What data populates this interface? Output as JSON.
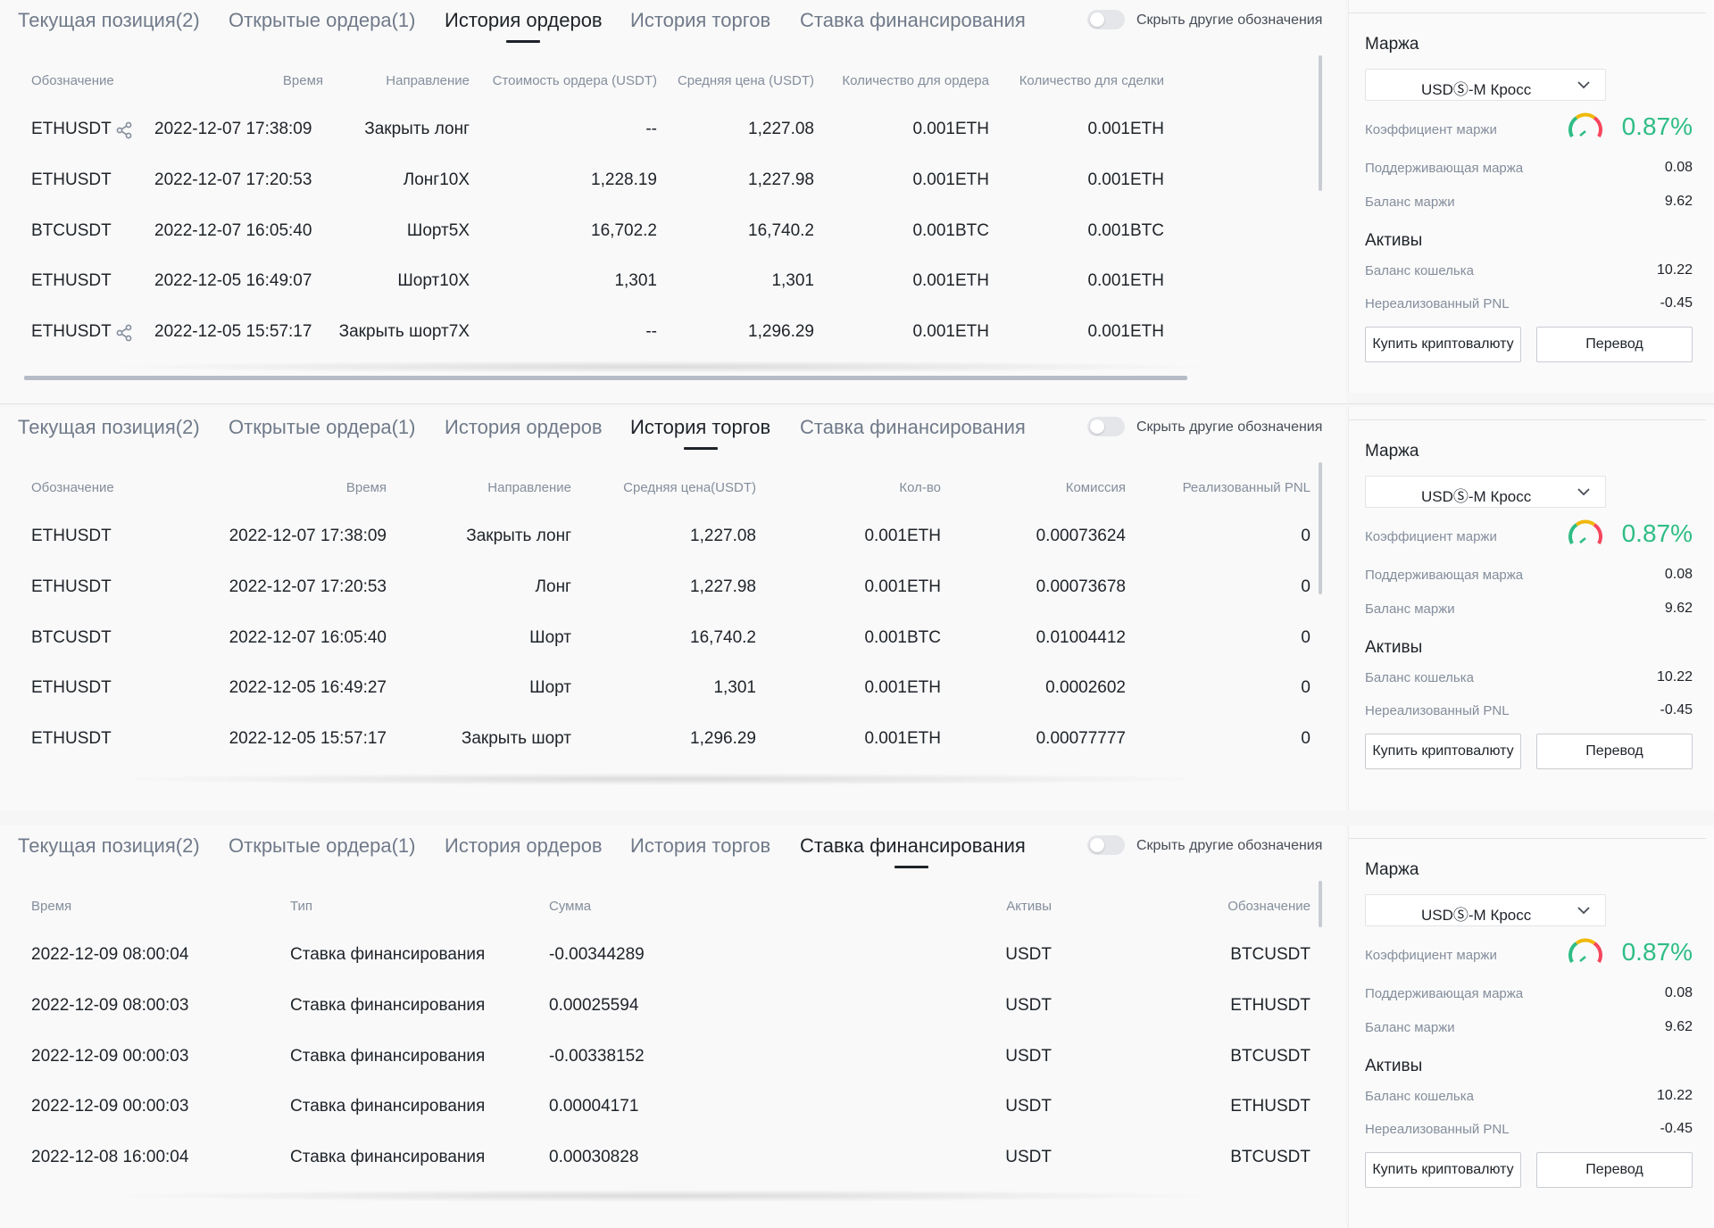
{
  "tabs": {
    "current_position": "Текущая позиция(2)",
    "open_orders": "Открытые ордера(1)",
    "order_history": "История ордеров",
    "trade_history": "История торгов",
    "funding_rate": "Ставка финансирования"
  },
  "hide_other_symbols": "Скрыть другие обозначения",
  "order_history": {
    "headers": [
      "Обозначение",
      "Время",
      "Направление",
      "Стоимость ордера (USDT)",
      "Средняя цена (USDT)",
      "Количество для ордера",
      "Количество для сделки"
    ],
    "rows": [
      [
        "ETHUSDT",
        "2022-12-07 17:38:09",
        "Закрыть лонг",
        "--",
        "1,227.08",
        "0.001ETH",
        "0.001ETH"
      ],
      [
        "ETHUSDT",
        "2022-12-07 17:20:53",
        "Лонг10X",
        "1,228.19",
        "1,227.98",
        "0.001ETH",
        "0.001ETH"
      ],
      [
        "BTCUSDT",
        "2022-12-07 16:05:40",
        "Шорт5X",
        "16,702.2",
        "16,740.2",
        "0.001BTC",
        "0.001BTC"
      ],
      [
        "ETHUSDT",
        "2022-12-05 16:49:07",
        "Шорт10X",
        "1,301",
        "1,301",
        "0.001ETH",
        "0.001ETH"
      ],
      [
        "ETHUSDT",
        "2022-12-05 15:57:17",
        "Закрыть шорт7X",
        "--",
        "1,296.29",
        "0.001ETH",
        "0.001ETH"
      ]
    ]
  },
  "trade_history": {
    "headers": [
      "Обозначение",
      "Время",
      "Направление",
      "Средняя цена(USDT)",
      "Кол-во",
      "Комиссия",
      "Реализованный PNL"
    ],
    "rows": [
      [
        "ETHUSDT",
        "2022-12-07 17:38:09",
        "Закрыть лонг",
        "1,227.08",
        "0.001ETH",
        "0.00073624",
        "0"
      ],
      [
        "ETHUSDT",
        "2022-12-07 17:20:53",
        "Лонг",
        "1,227.98",
        "0.001ETH",
        "0.00073678",
        "0"
      ],
      [
        "BTCUSDT",
        "2022-12-07 16:05:40",
        "Шорт",
        "16,740.2",
        "0.001BTC",
        "0.01004412",
        "0"
      ],
      [
        "ETHUSDT",
        "2022-12-05 16:49:27",
        "Шорт",
        "1,301",
        "0.001ETH",
        "0.0002602",
        "0"
      ],
      [
        "ETHUSDT",
        "2022-12-05 15:57:17",
        "Закрыть шорт",
        "1,296.29",
        "0.001ETH",
        "0.00077777",
        "0"
      ]
    ]
  },
  "funding": {
    "headers": [
      "Время",
      "Тип",
      "Сумма",
      "Активы",
      "Обозначение"
    ],
    "rows": [
      [
        "2022-12-09 08:00:04",
        "Ставка финансирования",
        "-0.00344289",
        "USDT",
        "BTCUSDT"
      ],
      [
        "2022-12-09 08:00:03",
        "Ставка финансирования",
        "0.00025594",
        "USDT",
        "ETHUSDT"
      ],
      [
        "2022-12-09 00:00:03",
        "Ставка финансирования",
        "-0.00338152",
        "USDT",
        "BTCUSDT"
      ],
      [
        "2022-12-09 00:00:03",
        "Ставка финансирования",
        "0.00004171",
        "USDT",
        "ETHUSDT"
      ],
      [
        "2022-12-08 16:00:04",
        "Ставка финансирования",
        "0.00030828",
        "USDT",
        "BTCUSDT"
      ]
    ]
  },
  "margin": {
    "title": "Маржа",
    "mode": "USDⓈ-M Кросс",
    "ratio_label": "Коэффициент маржи",
    "ratio_value": "0.87%",
    "maintenance_label": "Поддерживающая маржа",
    "maintenance_value": "0.08",
    "balance_label": "Баланс маржи",
    "balance_value": "9.62",
    "assets_title": "Активы",
    "wallet_label": "Баланс кошелька",
    "wallet_value": "10.22",
    "pnl_label": "Нереализованный PNL",
    "pnl_value": "-0.45",
    "buy_button": "Купить криптовалюту",
    "transfer_button": "Перевод"
  },
  "colors": {
    "green": "#2ebd85",
    "text": "#1e2329",
    "muted": "#848e9c"
  }
}
